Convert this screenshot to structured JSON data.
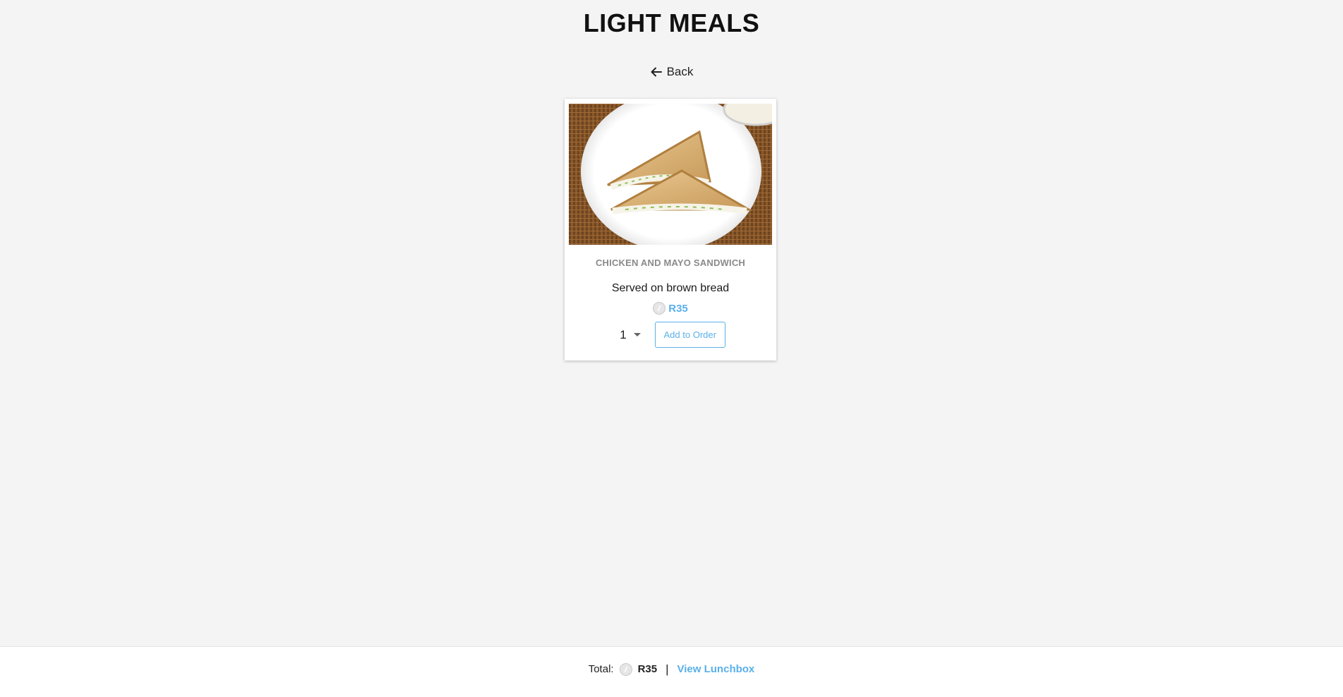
{
  "page": {
    "title": "LIGHT MEALS",
    "back_label": "Back"
  },
  "product": {
    "name": "CHICKEN AND MAYO SANDWICH",
    "description": "Served on brown bread",
    "price": "R35",
    "image_icon": "sandwich-photo",
    "quantity": "1",
    "add_label": "Add to Order"
  },
  "footer": {
    "total_label": "Total:",
    "total_value": "R35",
    "separator": "|",
    "view_label": "View Lunchbox"
  },
  "colors": {
    "accent": "#5ab0ea",
    "background": "#f4f4f4",
    "card": "#ffffff"
  }
}
